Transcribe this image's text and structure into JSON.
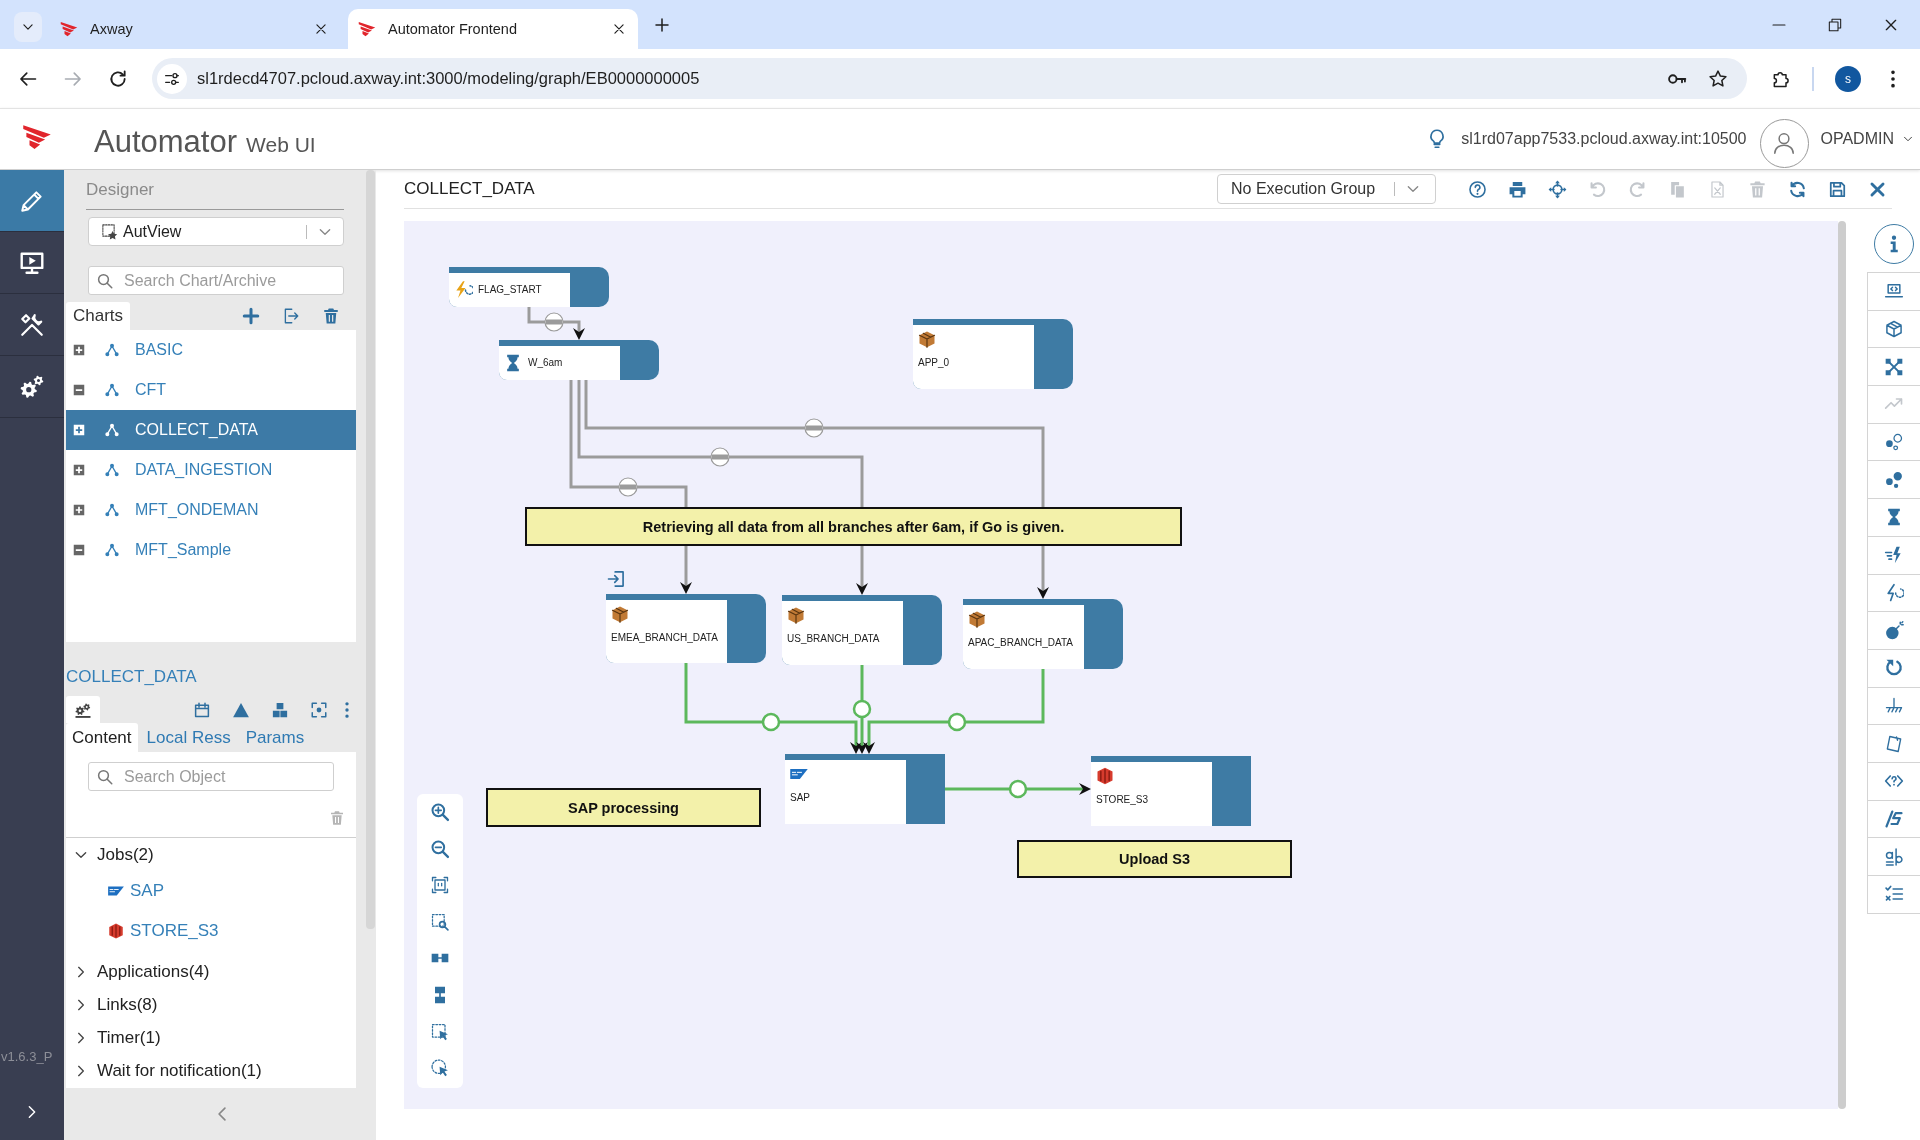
{
  "browser": {
    "tabs": [
      {
        "title": "Axway",
        "selected": false
      },
      {
        "title": "Automator Frontend",
        "selected": true
      }
    ],
    "nav_buttons": [
      {
        "kind": "back",
        "disabled": false
      },
      {
        "kind": "forward",
        "disabled": true
      },
      {
        "kind": "reload",
        "disabled": false
      }
    ],
    "url": "sl1rdecd4707.pcloud.axway.int:3000/modeling/graph/EB0000000005",
    "profile_initial": "s"
  },
  "app_header": {
    "title": "Automator",
    "subtitle": "Web UI",
    "server": "sl1rd07app7533.pcloud.axway.int:10500",
    "user": "OPADMIN"
  },
  "nav_rail": {
    "items": [
      {
        "kind": "designer",
        "selected": true
      },
      {
        "kind": "monitor",
        "selected": false
      },
      {
        "kind": "tools",
        "selected": false
      },
      {
        "kind": "settings",
        "selected": false
      }
    ],
    "version": "v1.6.3_P"
  },
  "designer_panel": {
    "title": "Designer",
    "view_select": {
      "value": "AutView"
    },
    "search": {
      "placeholder": "Search Chart/Archive"
    },
    "tabs": [
      {
        "label": "Charts",
        "selected": true
      }
    ],
    "charts": [
      {
        "name": "BASIC",
        "expanded": false,
        "selected": false
      },
      {
        "name": "CFT",
        "expanded": true,
        "selected": false
      },
      {
        "name": "COLLECT_DATA",
        "expanded": false,
        "selected": true
      },
      {
        "name": "DATA_INGESTION",
        "expanded": false,
        "selected": false
      },
      {
        "name": "MFT_ONDEMAN",
        "expanded": false,
        "selected": false
      },
      {
        "name": "MFT_Sample",
        "expanded": true,
        "selected": false
      }
    ]
  },
  "chart_panel": {
    "title": "COLLECT_DATA",
    "object_tabs": [
      {
        "kind": "cogs",
        "selected": true
      },
      {
        "kind": "calendar",
        "selected": false
      },
      {
        "kind": "triangle",
        "selected": false
      },
      {
        "kind": "cubes",
        "selected": false
      },
      {
        "kind": "focus",
        "selected": false
      },
      {
        "kind": "more",
        "selected": false
      }
    ],
    "tabs": [
      {
        "label": "Content",
        "selected": true
      },
      {
        "label": "Local Ress",
        "selected": false
      },
      {
        "label": "Params",
        "selected": false
      }
    ],
    "search": {
      "placeholder": "Search Object"
    },
    "tree": [
      {
        "label": "Jobs(2)",
        "expanded": true,
        "children": [
          {
            "label": "SAP",
            "kind": "sap"
          },
          {
            "label": "STORE_S3",
            "kind": "s3"
          }
        ]
      },
      {
        "label": "Applications(4)",
        "expanded": false
      },
      {
        "label": "Links(8)",
        "expanded": false
      },
      {
        "label": "Timer(1)",
        "expanded": false
      },
      {
        "label": "Wait for notification(1)",
        "expanded": false
      }
    ]
  },
  "editor": {
    "title": "COLLECT_DATA",
    "execution_group": {
      "value": "No Execution Group"
    },
    "toolbar": [
      {
        "kind": "help",
        "disabled": false
      },
      {
        "kind": "print",
        "disabled": false
      },
      {
        "kind": "move",
        "disabled": false
      },
      {
        "kind": "undo",
        "disabled": true
      },
      {
        "kind": "redo",
        "disabled": true
      },
      {
        "kind": "copy",
        "disabled": true
      },
      {
        "kind": "export_excel",
        "disabled": true
      },
      {
        "kind": "delete",
        "disabled": true
      },
      {
        "kind": "refresh",
        "disabled": false
      },
      {
        "kind": "save",
        "disabled": false
      },
      {
        "kind": "close",
        "disabled": false
      }
    ],
    "nodes": [
      {
        "kind": "flag",
        "label": "FLAG_START",
        "entry": false
      },
      {
        "kind": "timer",
        "label": "W_6am",
        "entry": false
      },
      {
        "kind": "application",
        "label": "APP_0",
        "entry": false
      },
      {
        "kind": "application",
        "label": "EMEA_BRANCH_DATA",
        "entry": true
      },
      {
        "kind": "application",
        "label": "US_BRANCH_DATA",
        "entry": false
      },
      {
        "kind": "application",
        "label": "APAC_BRANCH_DATA",
        "entry": false
      },
      {
        "kind": "sap_job",
        "label": "SAP",
        "entry": false
      },
      {
        "kind": "s3_job",
        "label": "STORE_S3",
        "entry": false
      }
    ],
    "links": [
      {
        "kind": "conditional"
      },
      {
        "kind": "conditional"
      },
      {
        "kind": "conditional"
      },
      {
        "kind": "conditional"
      },
      {
        "kind": "success"
      },
      {
        "kind": "success"
      },
      {
        "kind": "success"
      },
      {
        "kind": "success"
      }
    ],
    "comments": [
      "Retrieving all data from all branches after 6am, if Go is given.",
      "SAP processing",
      "Upload S3"
    ],
    "palette": [
      {
        "kind": "script",
        "disabled": false
      },
      {
        "kind": "application",
        "disabled": false
      },
      {
        "kind": "network",
        "disabled": false
      },
      {
        "kind": "trend",
        "disabled": true
      },
      {
        "kind": "bubbles_outline",
        "disabled": false
      },
      {
        "kind": "bubbles",
        "disabled": false
      },
      {
        "kind": "timer",
        "disabled": false
      },
      {
        "kind": "trigger",
        "disabled": false
      },
      {
        "kind": "flag",
        "disabled": false
      },
      {
        "kind": "bomb",
        "disabled": false
      },
      {
        "kind": "loop",
        "disabled": false
      },
      {
        "kind": "ground",
        "disabled": false
      },
      {
        "kind": "note",
        "disabled": false
      },
      {
        "kind": "code",
        "disabled": false
      },
      {
        "kind": "signal",
        "disabled": false
      },
      {
        "kind": "compare",
        "disabled": false
      },
      {
        "kind": "checklist",
        "disabled": false
      }
    ]
  }
}
